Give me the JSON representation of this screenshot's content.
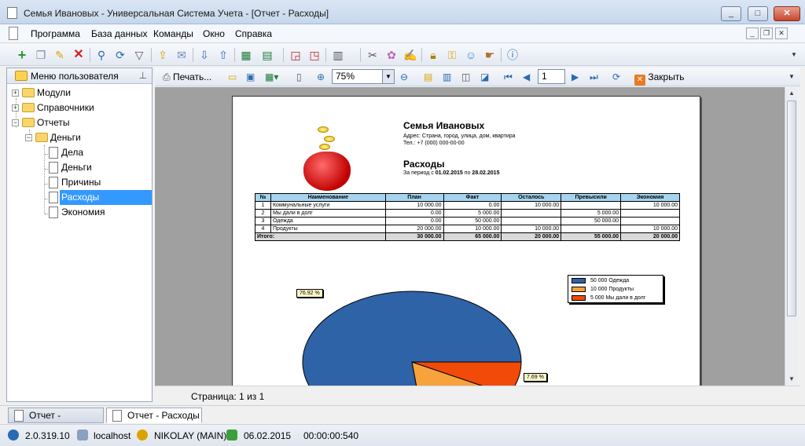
{
  "window": {
    "title": "Семья Ивановых - Универсальная Система Учета - [Отчет - Расходы]",
    "minimize": "_",
    "maximize": "□",
    "close": "✕"
  },
  "menu": [
    "Программа",
    "База данных",
    "Команды",
    "Окно",
    "Справка"
  ],
  "toolbar_icons": [
    "add-icon",
    "copy-icon",
    "edit-icon",
    "delete-icon",
    "search-icon",
    "refresh-icon",
    "filter-icon",
    "export-icon",
    "comment-icon",
    "import-icon",
    "upload-icon",
    "excel-icon",
    "excel-export-icon",
    "new-window-icon",
    "window-icon",
    "tools-icon",
    "settings-icon",
    "palette-icon",
    "note-icon",
    "lock-icon",
    "key-icon",
    "users-icon",
    "hand-icon",
    "info-icon"
  ],
  "left_panel": {
    "title": "Меню пользователя",
    "tree": [
      {
        "label": "Модули",
        "expander": "+"
      },
      {
        "label": "Справочники",
        "expander": "+"
      },
      {
        "label": "Отчеты",
        "expander": "−"
      },
      {
        "label": "Деньги",
        "expander": "−"
      },
      {
        "label": "Дела"
      },
      {
        "label": "Деньги"
      },
      {
        "label": "Причины"
      },
      {
        "label": "Расходы",
        "selected": true
      },
      {
        "label": "Экономия"
      }
    ]
  },
  "report_toolbar": {
    "print_label": "Печать...",
    "zoom": "75%",
    "page": "1",
    "close_label": "Закрыть"
  },
  "report": {
    "company": "Семья Ивановых",
    "address_line1": "Адрес: Страна, город, улица, дом, квартира",
    "address_line2": "Тел.: +7 (000) 000-00-00",
    "title": "Расходы",
    "period_prefix": "За период с",
    "period_from": "01.02.2015",
    "period_to_prefix": "по",
    "period_to": "28.02.2015",
    "table": {
      "headers": [
        "№",
        "Наименование",
        "План",
        "Факт",
        "Осталось",
        "Превысили",
        "Экономия"
      ],
      "rows": [
        [
          "1",
          "Коммунальные услуги",
          "10 000.00",
          "0.00",
          "10 000.00",
          "",
          "10 000.00"
        ],
        [
          "2",
          "Мы дали в долг",
          "0.00",
          "5 000.00",
          "",
          "5 000.00",
          ""
        ],
        [
          "3",
          "Одежда",
          "0.00",
          "50 000.00",
          "",
          "50 000.00",
          ""
        ],
        [
          "4",
          "Продукты",
          "20 000.00",
          "10 000.00",
          "10 000.00",
          "",
          "10 000.00"
        ]
      ],
      "total": [
        "Итого:",
        "30 000.00",
        "65 000.00",
        "20 000.00",
        "55 000.00",
        "20 000.00"
      ]
    }
  },
  "chart_data": {
    "type": "pie",
    "categories": [
      "Одежда",
      "Продукты",
      "Мы дали в долг"
    ],
    "values": [
      50000,
      10000,
      5000
    ],
    "legend_labels": [
      "50 000 Одежда",
      "10 000 Продукты",
      "5 000 Мы дали в долг"
    ],
    "colors": [
      "#2e63a8",
      "#f7a23a",
      "#f24a08"
    ],
    "visible_slice_labels": [
      "76.92 %",
      "7.69 %"
    ],
    "legend_position": "top-right"
  },
  "status_line": "Страница: 1 из 1",
  "doc_tabs": [
    "Отчет - Экономия",
    "Отчет - Расходы"
  ],
  "statusbar": {
    "version": "2.0.319.10",
    "host": "localhost",
    "user": "NIKOLAY (MAIN)",
    "date": "06.02.2015",
    "timer": "00:00:00:540"
  }
}
